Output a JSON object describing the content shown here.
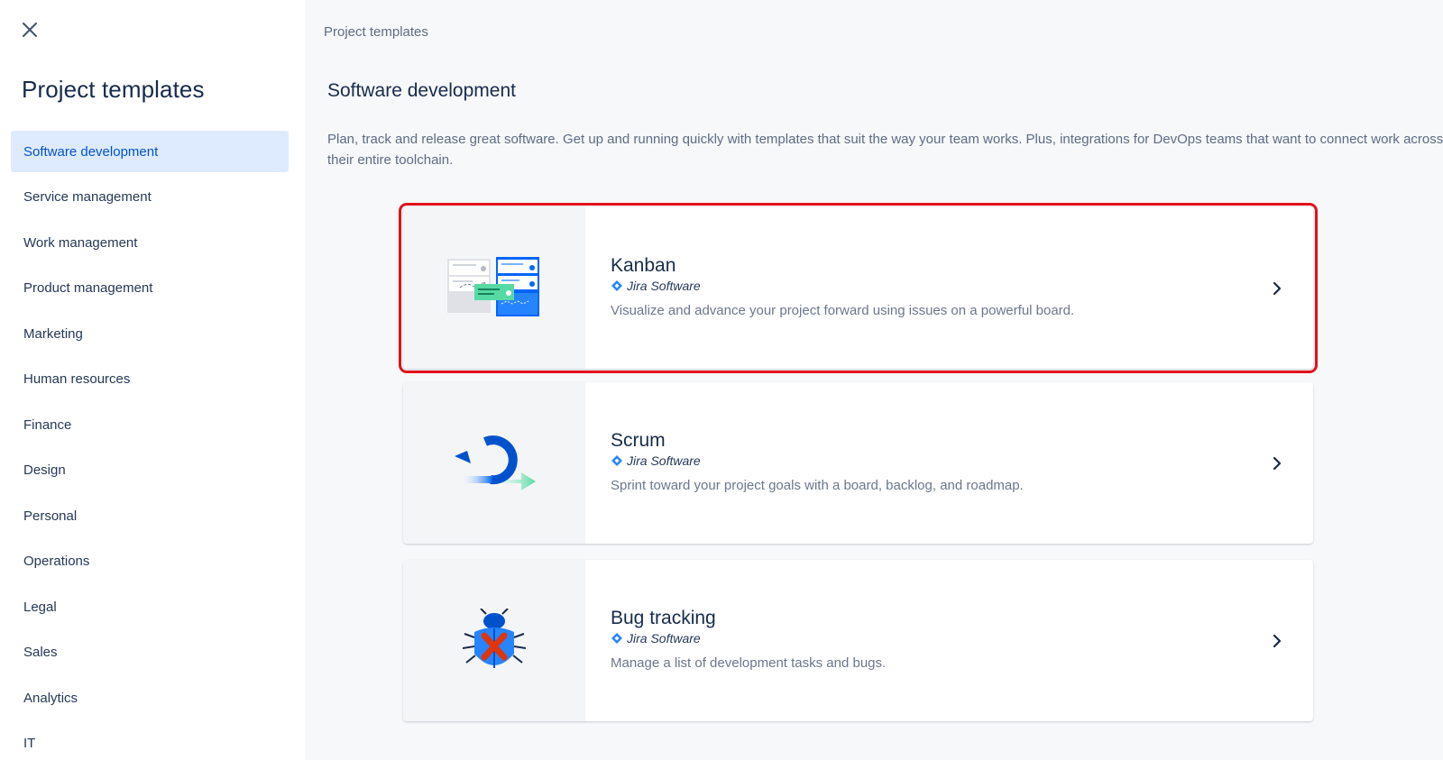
{
  "sidebar": {
    "title": "Project templates",
    "items": [
      {
        "label": "Software development",
        "active": true
      },
      {
        "label": "Service management"
      },
      {
        "label": "Work management"
      },
      {
        "label": "Product management"
      },
      {
        "label": "Marketing"
      },
      {
        "label": "Human resources"
      },
      {
        "label": "Finance"
      },
      {
        "label": "Design"
      },
      {
        "label": "Personal"
      },
      {
        "label": "Operations"
      },
      {
        "label": "Legal"
      },
      {
        "label": "Sales"
      },
      {
        "label": "Analytics"
      },
      {
        "label": "IT"
      }
    ]
  },
  "main": {
    "breadcrumb": "Project templates",
    "title": "Software development",
    "description": "Plan, track and release great software. Get up and running quickly with templates that suit the way your team works. Plus, integrations for DevOps teams that want to connect work across their entire toolchain.",
    "templates": [
      {
        "title": "Kanban",
        "product": "Jira Software",
        "description": "Visualize and advance your project forward using issues on a powerful board.",
        "icon": "kanban-board-illustration"
      },
      {
        "title": "Scrum",
        "product": "Jira Software",
        "description": "Sprint toward your project goals with a board, backlog, and roadmap.",
        "icon": "scrum-cycle-illustration"
      },
      {
        "title": "Bug tracking",
        "product": "Jira Software",
        "description": "Manage a list of development tasks and bugs.",
        "icon": "bug-illustration"
      }
    ]
  },
  "colors": {
    "accent": "#0052cc",
    "active_bg": "#deebff",
    "highlight": "#e2111a",
    "main_bg": "#f7f8f9"
  }
}
